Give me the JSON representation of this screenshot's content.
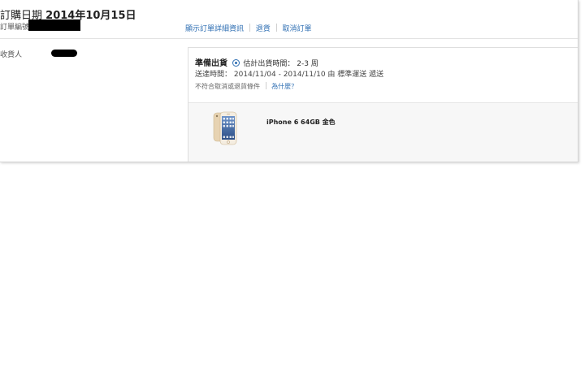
{
  "order": {
    "date_label": "訂購日期",
    "date_value": "2014年10月15日",
    "number_label": "訂單編號"
  },
  "actions": {
    "details": "顯示訂單詳細資訊",
    "return": "退貨",
    "cancel": "取消訂單"
  },
  "recipient": {
    "label": "收貨人"
  },
  "shipment": {
    "status": "準備出貨",
    "eta": "估計出貨時間： 2-3 周",
    "delivery": "送達時間： 2014/11/04 - 2014/11/10 由 標準運送 遞送",
    "policy": "不符合取消或退貨條件",
    "why_link": "為什麼？"
  },
  "item": {
    "name": "iPhone 6 64GB 金色"
  },
  "colors": {
    "link": "#2f6fb3",
    "redaction": "#000000"
  }
}
